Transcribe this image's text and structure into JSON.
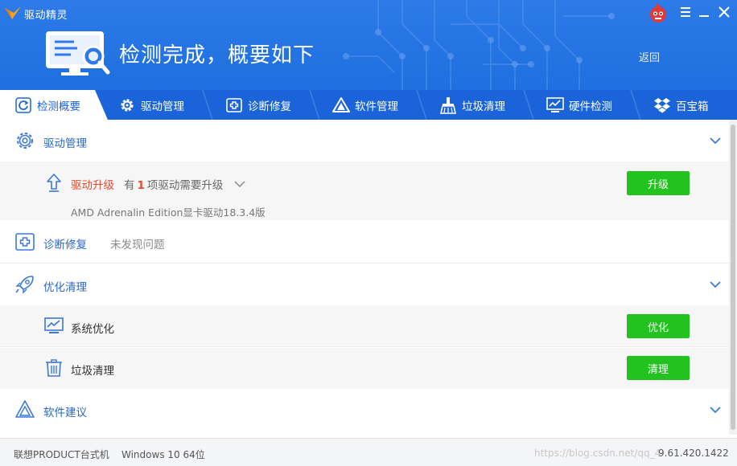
{
  "app": {
    "title": "驱动精灵",
    "headline": "检测完成，概要如下",
    "back_label": "返回"
  },
  "window_controls": [
    "menu-icon",
    "minimize-icon",
    "close-icon"
  ],
  "tabs": [
    {
      "label": "检测概要",
      "icon": "refresh-icon",
      "active": true
    },
    {
      "label": "驱动管理",
      "icon": "gear-icon",
      "active": false
    },
    {
      "label": "诊断修复",
      "icon": "medical-cross-icon",
      "active": false
    },
    {
      "label": "软件管理",
      "icon": "triangle-icon",
      "active": false
    },
    {
      "label": "垃圾清理",
      "icon": "broom-icon",
      "active": false
    },
    {
      "label": "硬件检测",
      "icon": "monitor-chart-icon",
      "active": false
    },
    {
      "label": "百宝箱",
      "icon": "dropbox-icon",
      "active": false
    }
  ],
  "sections": {
    "driver": {
      "label": "驱动管理",
      "upgrade_label": "驱动升级",
      "upgrade_prefix": "有",
      "upgrade_count": "1",
      "upgrade_suffix": "项驱动需要升级",
      "upgrade_detail": "AMD Adrenalin Edition显卡驱动18.3.4版",
      "upgrade_button": "升级"
    },
    "diagnose": {
      "label": "诊断修复",
      "status": "未发现问题"
    },
    "optimize": {
      "label": "优化清理",
      "items": [
        {
          "label": "系统优化",
          "button": "优化",
          "icon": "monitor-chart-icon"
        },
        {
          "label": "垃圾清理",
          "button": "清理",
          "icon": "trash-icon"
        }
      ]
    },
    "software": {
      "label": "软件建议"
    }
  },
  "footer": {
    "pc_model": "联想PRODUCT台式机",
    "os": "Windows 10 64位",
    "version": "9.61.420.1422",
    "watermark": "https://blog.csdn.net/qq_4"
  },
  "colors": {
    "header_blue": "#2d7ae8",
    "tab_blue": "#1b63d8",
    "accent_link": "#2a67c8",
    "upgrade_red": "#e64a2e",
    "button_green": "#22c31e"
  }
}
